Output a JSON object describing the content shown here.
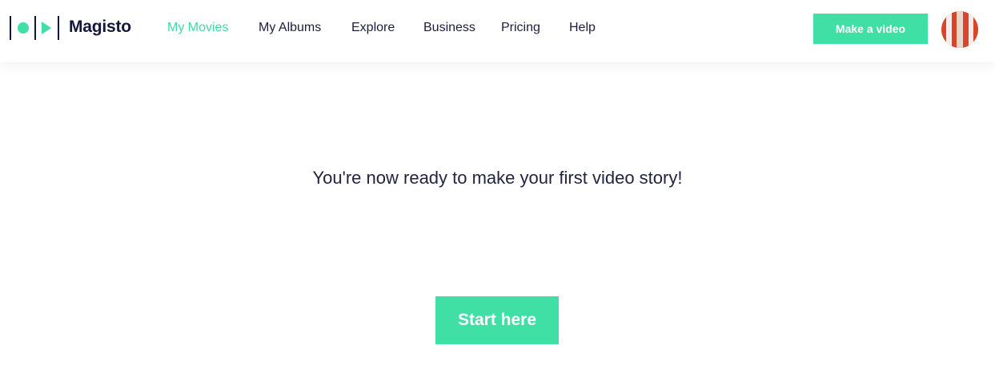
{
  "header": {
    "brand": "Magisto",
    "logo_icon": "magisto-logo-icon",
    "nav": [
      {
        "label": "My Movies",
        "active": true
      },
      {
        "label": "My Albums",
        "active": false
      },
      {
        "label": "Explore",
        "active": false
      },
      {
        "label": "Business",
        "active": false
      },
      {
        "label": "Pricing",
        "active": false
      },
      {
        "label": "Help",
        "active": false
      }
    ],
    "cta_label": "Make a video",
    "avatar_icon": "user-avatar"
  },
  "main": {
    "message": "You're now ready to make your first video story!",
    "start_label": "Start here"
  },
  "colors": {
    "accent": "#3fdfa6",
    "text": "#1b1e3a",
    "avatar_red": "#d8462a"
  }
}
